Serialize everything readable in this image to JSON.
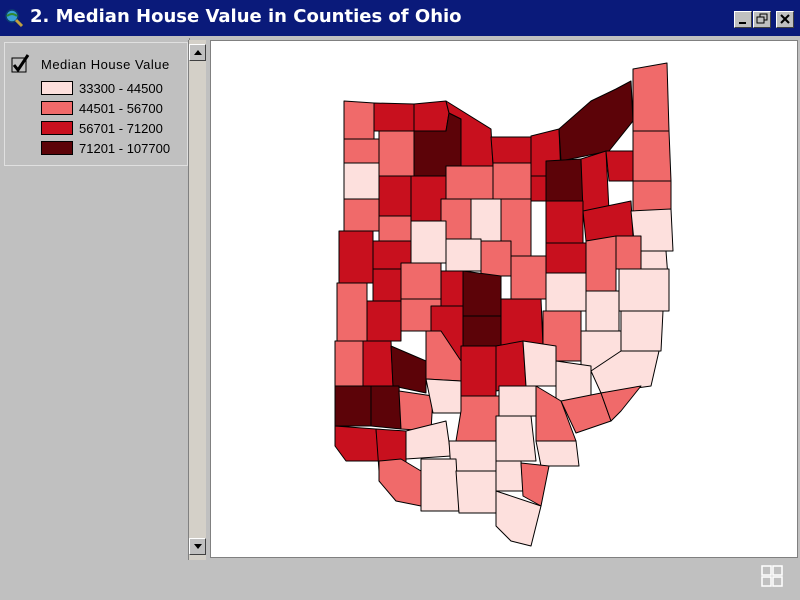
{
  "window": {
    "title": "2. Median House Value in Counties of Ohio",
    "titlebar_color": "#0a1a7a"
  },
  "legend": {
    "title": "Median House Value",
    "visible_checked": true,
    "classes": [
      {
        "label": "33300 - 44500",
        "color": "#fde0dd"
      },
      {
        "label": "44501 - 56700",
        "color": "#f06a6a"
      },
      {
        "label": "56701 - 71200",
        "color": "#c8101e"
      },
      {
        "label": "71201 - 107700",
        "color": "#5c0308"
      }
    ]
  },
  "map": {
    "region": "Counties of Ohio",
    "stroke_color": "#000000",
    "background": "#ffffff"
  },
  "icons": {
    "app": "globe-search-icon",
    "visibility": "checkmark-icon",
    "minimize": "minimize-icon",
    "restore": "restore-icon",
    "close": "close-icon",
    "scroll_up": "arrow-up-icon",
    "scroll_down": "arrow-down-icon",
    "grip": "grid-icon"
  }
}
